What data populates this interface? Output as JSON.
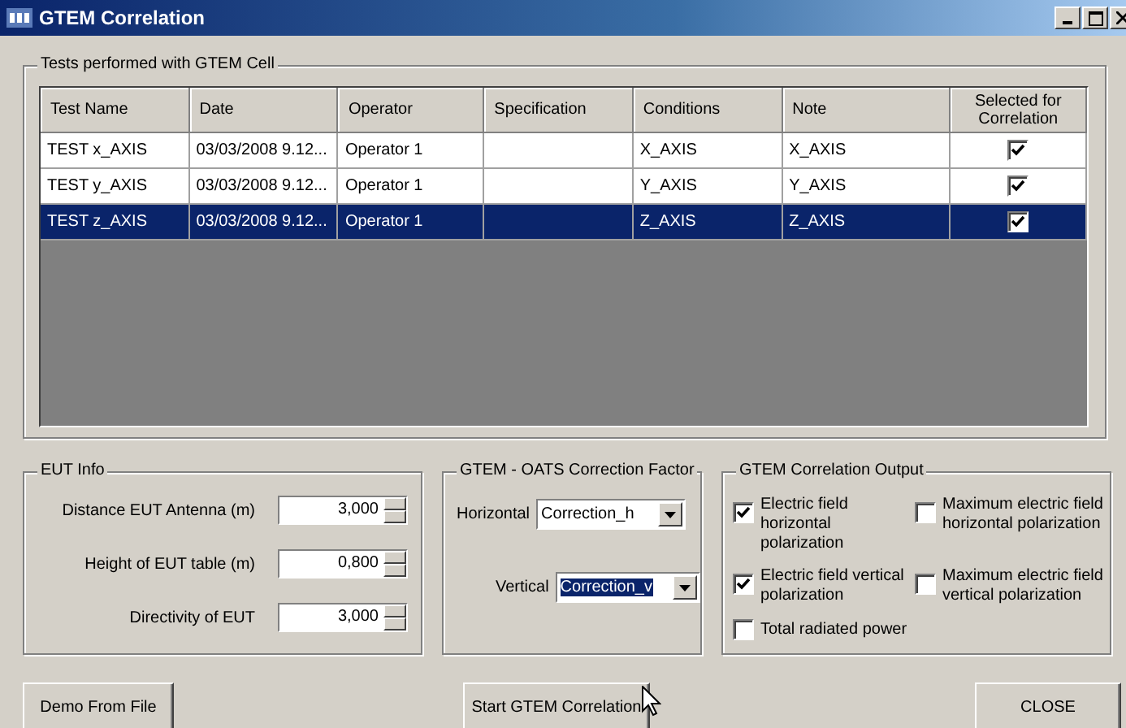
{
  "window": {
    "title": "GTEM Correlation"
  },
  "tests": {
    "title": "Tests performed with GTEM Cell",
    "columns": [
      "Test Name",
      "Date",
      "Operator",
      "Specification",
      "Conditions",
      "Note",
      "Selected for Correlation"
    ],
    "rows": [
      {
        "test_name": "TEST x_AXIS",
        "date": "03/03/2008 9.12...",
        "operator": "Operator 1",
        "specification": "",
        "conditions": "X_AXIS",
        "note": "X_AXIS",
        "checked": true,
        "selected": false
      },
      {
        "test_name": "TEST y_AXIS",
        "date": "03/03/2008 9.12...",
        "operator": "Operator 1",
        "specification": "",
        "conditions": "Y_AXIS",
        "note": "Y_AXIS",
        "checked": true,
        "selected": false
      },
      {
        "test_name": "TEST z_AXIS",
        "date": "03/03/2008 9.12...",
        "operator": "Operator 1",
        "specification": "",
        "conditions": "Z_AXIS",
        "note": "Z_AXIS",
        "checked": true,
        "selected": true
      }
    ]
  },
  "eut_info": {
    "title": "EUT Info",
    "fields": [
      {
        "label": "Distance EUT Antenna (m)",
        "value": "3,000"
      },
      {
        "label": "Height of EUT table (m)",
        "value": "0,800"
      },
      {
        "label": "Directivity of EUT",
        "value": "3,000"
      }
    ]
  },
  "correction": {
    "title": "GTEM - OATS Correction  Factor",
    "fields": [
      {
        "label": "Horizontal",
        "value": "Correction_h",
        "selected": false
      },
      {
        "label": "Vertical",
        "value": "Correction_v",
        "selected": true
      }
    ]
  },
  "output": {
    "title": "GTEM Correlation Output",
    "options": [
      {
        "label": "Electric field horizontal polarization",
        "checked": true
      },
      {
        "label": "Maximum electric field horizontal polarization",
        "checked": false
      },
      {
        "label": "Electric field vertical polarization",
        "checked": true
      },
      {
        "label": "Maximum electric field vertical polarization",
        "checked": false
      },
      {
        "label": "Total radiated power",
        "checked": false
      }
    ]
  },
  "buttons": [
    "Demo From File",
    "Start GTEM Correlation",
    "CLOSE"
  ]
}
